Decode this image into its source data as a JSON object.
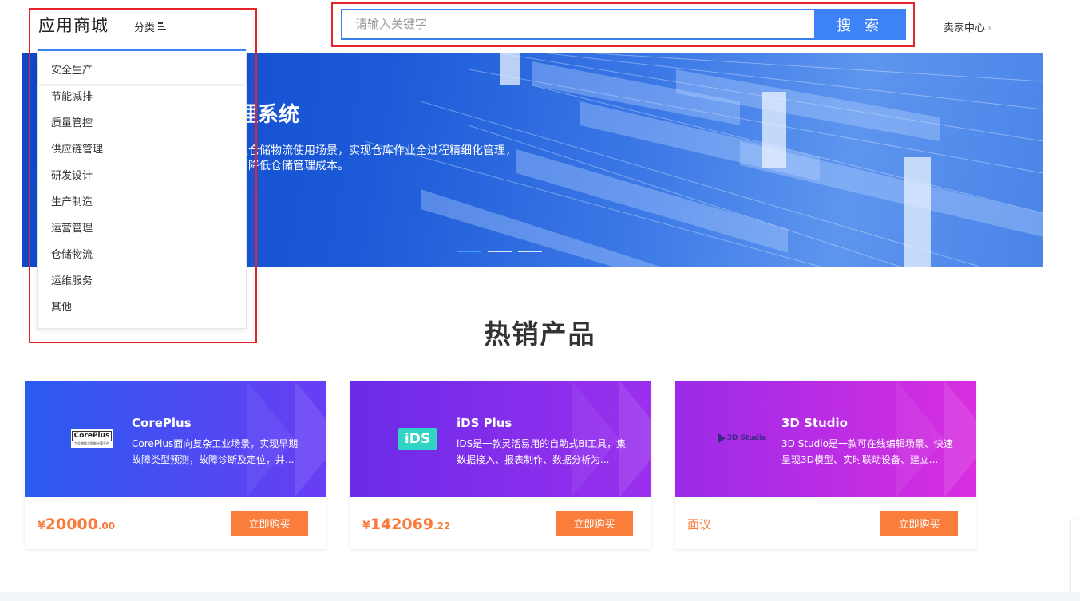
{
  "header": {
    "logo": "应用商城",
    "category_label": "分类",
    "search_placeholder": "请输入关键字",
    "search_button": "搜 索",
    "seller_center": "卖家中心",
    "chevron": "›"
  },
  "banner": {
    "title": "理系统",
    "desc_line1": "盖仓储物流使用场景，实现仓库作业全过程精细化管理，",
    "desc_line2": "，降低仓储管理成本。",
    "slides_count": 3,
    "active_slide": 1
  },
  "categories": [
    "安全生产",
    "节能减排",
    "质量管控",
    "供应链管理",
    "研发设计",
    "生产制造",
    "运营管理",
    "仓储物流",
    "运维服务",
    "其他"
  ],
  "hot": {
    "title": "热销产品",
    "products": [
      {
        "name": "CorePlus",
        "logo_text": "CorePlus",
        "logo_sub": "工业物联与智能计算平台",
        "desc": "CorePlus面向复杂工业场景，实现早期故障类型预测，故障诊断及定位，并...",
        "price_symbol": "¥",
        "price_int": "20000",
        "price_dec": ".00",
        "buy": "立即购买",
        "colors": [
          "#2a5bf0",
          "#6a3df5"
        ]
      },
      {
        "name": "iDS Plus",
        "logo_text": "iDS",
        "desc": "iDS是一款灵活易用的自助式BI工具，集数据接入、报表制作、数据分析为...",
        "price_symbol": "¥",
        "price_int": "142069",
        "price_dec": ".22",
        "buy": "立即购买",
        "colors": [
          "#6a2be8",
          "#9b30ee"
        ]
      },
      {
        "name": "3D Studio",
        "logo_text": "3D Studio",
        "desc": "3D Studio是一款可在线编辑场景、快速呈现3D模型、实时联动设备、建立...",
        "price_text": "面议",
        "buy": "立即购买",
        "colors": [
          "#9a2be8",
          "#d92ee0"
        ]
      }
    ]
  }
}
